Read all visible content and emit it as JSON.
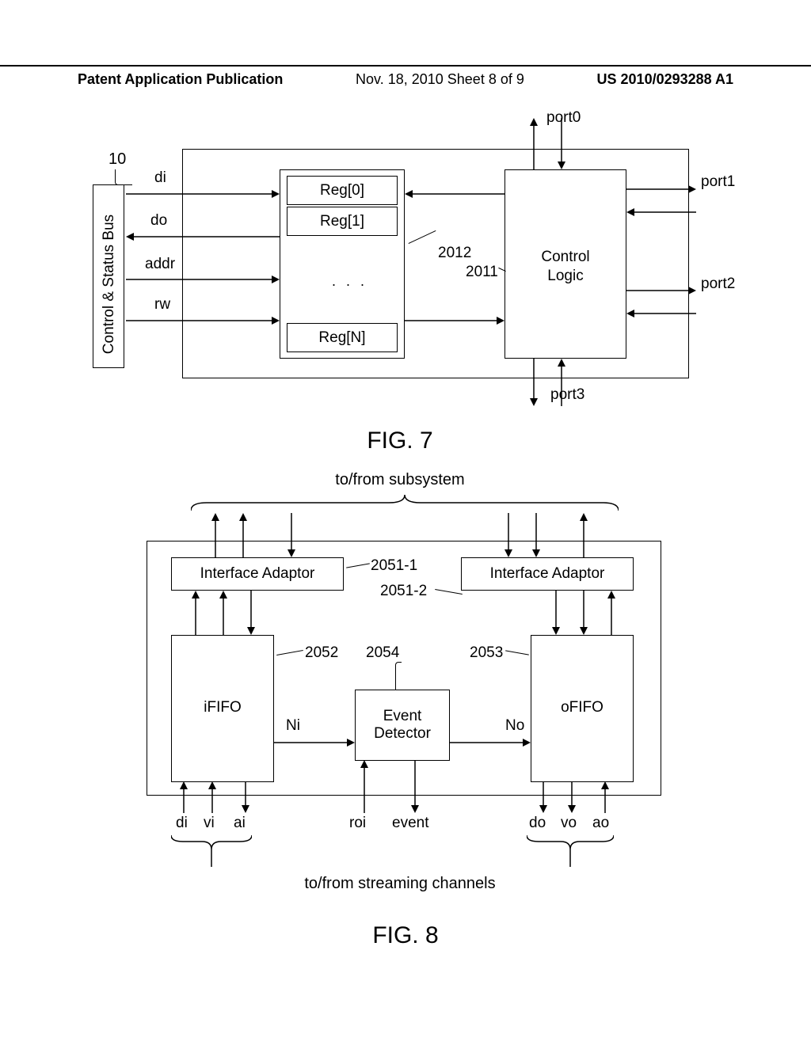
{
  "header": {
    "left": "Patent Application Publication",
    "center": "Nov. 18, 2010  Sheet 8 of 9",
    "right": "US 2010/0293288 A1"
  },
  "fig7": {
    "caption": "FIG. 7",
    "page_ref": "10",
    "bus_label": "Control & Status Bus",
    "bus_signals": {
      "di": "di",
      "do": "do",
      "addr": "addr",
      "rw": "rw"
    },
    "reg": {
      "r0": "Reg[0]",
      "r1": "Reg[1]",
      "dots": ". . .",
      "rN": "Reg[N]"
    },
    "reg_ref": "2012",
    "ctrl": "Control\nLogic",
    "ctrl_ref": "2011",
    "ports": {
      "p0": "port0",
      "p1": "port1",
      "p2": "port2",
      "p3": "port3"
    }
  },
  "fig8": {
    "caption": "FIG. 8",
    "top_label": "to/from subsystem",
    "ia": "Interface Adaptor",
    "ia1_ref": "2051-1",
    "ia2_ref": "2051-2",
    "ififo": "iFIFO",
    "ififo_ref": "2052",
    "ofifo": "oFIFO",
    "ofifo_ref": "2053",
    "evt": "Event\nDetector",
    "evt_ref": "2054",
    "ni": "Ni",
    "no": "No",
    "signals": {
      "di": "di",
      "vi": "vi",
      "ai": "ai",
      "roi": "roi",
      "event": "event",
      "do": "do",
      "vo": "vo",
      "ao": "ao"
    },
    "bottom_label": "to/from streaming channels"
  }
}
